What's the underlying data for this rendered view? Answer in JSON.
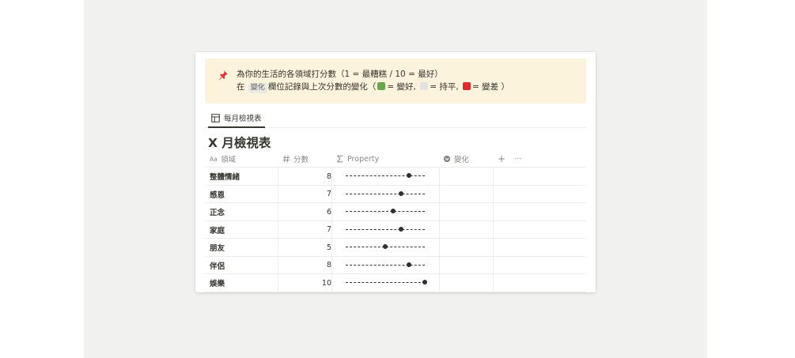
{
  "callout": {
    "icon": "pushpin-icon",
    "line1": "為你的生活的各領域打分數（1 = 最糟糕 / 10 = 最好）",
    "line2_prefix": "在",
    "line2_tag": "變化",
    "line2_mid": "欄位記錄與上次分數的變化（",
    "good_label": "= 變好,",
    "flat_label": "= 持平,",
    "bad_label": "= 變差 ）",
    "colors": {
      "good": "#6aa84f",
      "flat": "#e3e2e0",
      "bad": "#d9302f"
    }
  },
  "view_tab": {
    "icon": "table-icon",
    "label": "每月檢視表"
  },
  "database": {
    "title": "X 月檢視表"
  },
  "columns": {
    "area": {
      "icon": "text-property-icon",
      "label": "領域"
    },
    "score": {
      "icon": "number-property-icon",
      "label": "分數"
    },
    "property": {
      "icon": "formula-sigma-icon",
      "label": "Property"
    },
    "change": {
      "icon": "status-select-icon",
      "label": "變化"
    },
    "add": "+",
    "more": "···"
  },
  "rows": [
    {
      "area": "整體情緒",
      "score": "8",
      "score_value": 8
    },
    {
      "area": "感恩",
      "score": "7",
      "score_value": 7
    },
    {
      "area": "正念",
      "score": "6",
      "score_value": 6
    },
    {
      "area": "家庭",
      "score": "7",
      "score_value": 7
    },
    {
      "area": "朋友",
      "score": "5",
      "score_value": 5
    },
    {
      "area": "伴侶",
      "score": "8",
      "score_value": 8
    },
    {
      "area": "娛樂",
      "score": "10",
      "score_value": 10
    }
  ],
  "score_max": 10
}
